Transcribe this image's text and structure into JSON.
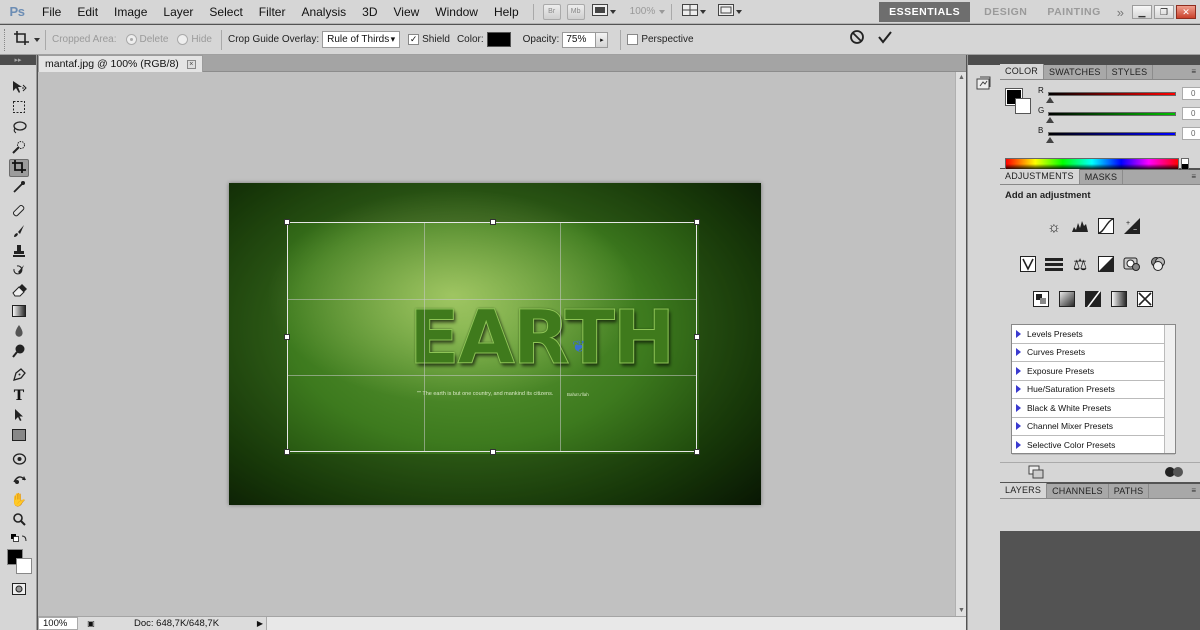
{
  "app": {
    "logo": "Ps",
    "menu": [
      "File",
      "Edit",
      "Image",
      "Layer",
      "Select",
      "Filter",
      "Analysis",
      "3D",
      "View",
      "Window",
      "Help"
    ],
    "zoom_dropdown": "100%",
    "mini_buttons": [
      "Br",
      "Mb"
    ],
    "workspaces": [
      "ESSENTIALS",
      "DESIGN",
      "PAINTING"
    ],
    "workspace_more": "»"
  },
  "options": {
    "cropped_area_label": "Cropped Area:",
    "delete_label": "Delete",
    "hide_label": "Hide",
    "guide_overlay_label": "Crop Guide Overlay:",
    "guide_overlay_value": "Rule of Thirds",
    "shield_label": "Shield",
    "shield_checked": "✓",
    "color_label": "Color:",
    "shield_color": "#000000",
    "opacity_label": "Opacity:",
    "opacity_value": "75%",
    "perspective_label": "Perspective"
  },
  "document": {
    "tab_title": "mantaf.jpg @ 100% (RGB/8)",
    "tab_close": "×",
    "artwork_word": "EARTH",
    "artwork_quote": "\"\" The earth is but one country, and mankind its citizens.",
    "artwork_signature": "Baha'u'llah"
  },
  "status": {
    "zoom": "100%",
    "doc_size": "Doc: 648,7K/648,7K"
  },
  "color_panel": {
    "tabs": [
      "COLOR",
      "SWATCHES",
      "STYLES"
    ],
    "channels": [
      {
        "label": "R",
        "value": "0",
        "gradient": "#ff0000"
      },
      {
        "label": "G",
        "value": "0",
        "gradient": "#00c000"
      },
      {
        "label": "B",
        "value": "0",
        "gradient": "#0000ff"
      }
    ]
  },
  "adjustments_panel": {
    "tabs": [
      "ADJUSTMENTS",
      "MASKS"
    ],
    "title": "Add an adjustment",
    "presets": [
      "Levels Presets",
      "Curves Presets",
      "Exposure Presets",
      "Hue/Saturation Presets",
      "Black & White Presets",
      "Channel Mixer Presets",
      "Selective Color Presets"
    ]
  },
  "layers_panel": {
    "tabs": [
      "LAYERS",
      "CHANNELS",
      "PATHS"
    ]
  },
  "colors": {
    "chrome": "#d6d6d6",
    "workspace_bg": "#c1c1c1",
    "dark": "#535353"
  }
}
